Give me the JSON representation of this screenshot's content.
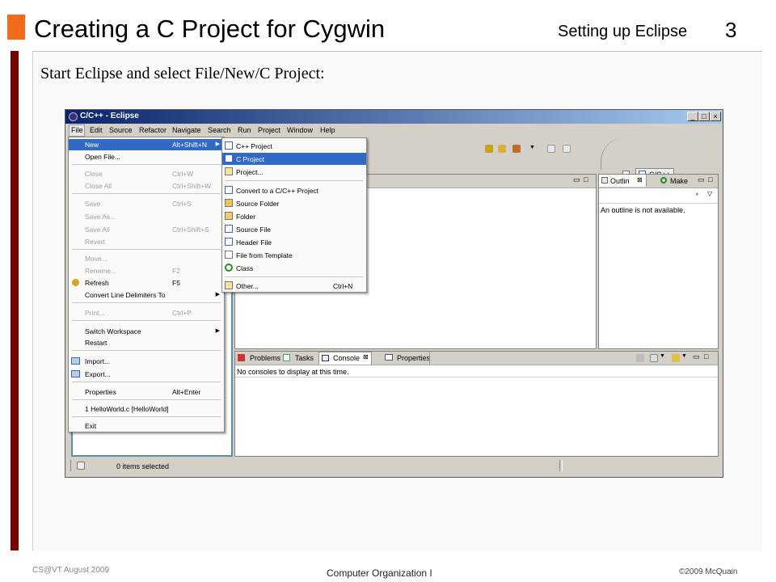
{
  "slide": {
    "title": "Creating a C Project for Cygwin",
    "section": "Setting up Eclipse",
    "page_number": "3",
    "intro": "Start Eclipse and select File/New/C Project:",
    "footer_left": "CS@VT August 2009",
    "footer_center": "Computer Organization I",
    "footer_right": "©2009  McQuain",
    "colors": {
      "accent_orange": "#f26b1d",
      "left_bar": "#7a0000",
      "title_bar": "#0a246a"
    }
  },
  "window": {
    "title": "C/C++ - Eclipse",
    "controls": [
      "_",
      "□",
      "×"
    ],
    "menus": [
      "File",
      "Edit",
      "Source",
      "Refactor",
      "Navigate",
      "Search",
      "Run",
      "Project",
      "Window",
      "Help"
    ],
    "perspective": "C/C++"
  },
  "file_menu": {
    "items": [
      {
        "label": "New",
        "shortcut": "Alt+Shift+N",
        "state": "selected",
        "submenu": true
      },
      {
        "label": "Open File...",
        "shortcut": "",
        "state": "enabled"
      },
      {
        "label": "Close",
        "shortcut": "Ctrl+W",
        "state": "disabled"
      },
      {
        "label": "Close All",
        "shortcut": "Ctrl+Shift+W",
        "state": "disabled"
      },
      {
        "label": "Save",
        "shortcut": "Ctrl+S",
        "state": "disabled"
      },
      {
        "label": "Save As...",
        "shortcut": "",
        "state": "disabled"
      },
      {
        "label": "Save All",
        "shortcut": "Ctrl+Shift+S",
        "state": "disabled"
      },
      {
        "label": "Revert",
        "shortcut": "",
        "state": "disabled"
      },
      {
        "label": "Move...",
        "shortcut": "",
        "state": "disabled"
      },
      {
        "label": "Rename...",
        "shortcut": "F2",
        "state": "disabled"
      },
      {
        "label": "Refresh",
        "shortcut": "F5",
        "state": "enabled"
      },
      {
        "label": "Convert Line Delimiters To",
        "shortcut": "",
        "state": "enabled",
        "submenu": true
      },
      {
        "label": "Print...",
        "shortcut": "Ctrl+P",
        "state": "disabled"
      },
      {
        "label": "Switch Workspace",
        "shortcut": "",
        "state": "enabled",
        "submenu": true
      },
      {
        "label": "Restart",
        "shortcut": "",
        "state": "enabled"
      },
      {
        "label": "Import...",
        "shortcut": "",
        "state": "enabled"
      },
      {
        "label": "Export...",
        "shortcut": "",
        "state": "enabled"
      },
      {
        "label": "Properties",
        "shortcut": "Alt+Enter",
        "state": "enabled"
      },
      {
        "label": "1 HelloWorld.c  [HelloWorld]",
        "shortcut": "",
        "state": "enabled"
      },
      {
        "label": "Exit",
        "shortcut": "",
        "state": "enabled"
      }
    ]
  },
  "new_menu": {
    "items": [
      {
        "label": "C++ Project",
        "shortcut": ""
      },
      {
        "label": "C Project",
        "shortcut": "",
        "state": "selected"
      },
      {
        "label": "Project...",
        "shortcut": ""
      },
      {
        "label": "Convert to a C/C++ Project",
        "shortcut": ""
      },
      {
        "label": "Source Folder",
        "shortcut": ""
      },
      {
        "label": "Folder",
        "shortcut": ""
      },
      {
        "label": "Source File",
        "shortcut": ""
      },
      {
        "label": "Header File",
        "shortcut": ""
      },
      {
        "label": "File from Template",
        "shortcut": ""
      },
      {
        "label": "Class",
        "shortcut": ""
      },
      {
        "label": "Other...",
        "shortcut": "Ctrl+N"
      }
    ]
  },
  "outline_view": {
    "tabs": [
      "Outlin",
      "Make"
    ],
    "message": "An outline is not available."
  },
  "console_view": {
    "tabs": [
      "Problems",
      "Tasks",
      "Console",
      "Properties"
    ],
    "message": "No consoles to display at this time."
  },
  "status": {
    "text": "0 items selected"
  }
}
